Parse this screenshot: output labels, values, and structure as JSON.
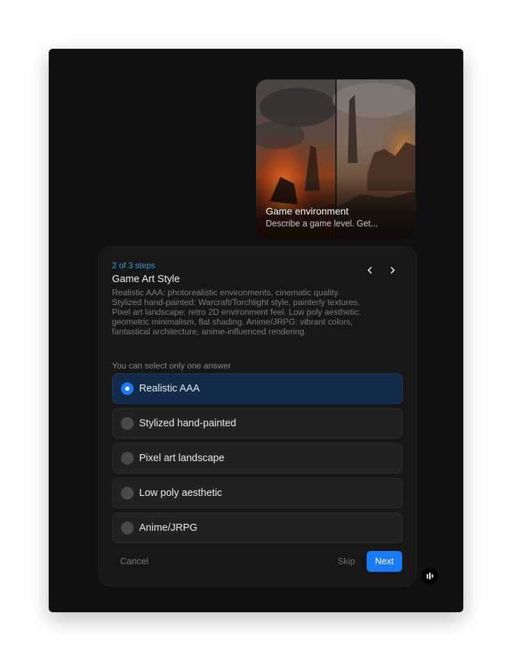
{
  "preview": {
    "title": "Game environment",
    "description": "Describe a game level. Get..."
  },
  "panel": {
    "step_count": "2 of 3 steps",
    "title": "Game Art Style",
    "description": "Realistic AAA: photorealistic environments, cinematic quality. Stylized hand-painted: Warcraft/Torchlight style, painterly textures. Pixel art landscape: retro 2D environment feel. Low poly aesthetic: geometric minimalism, flat shading. Anime/JRPG: vibrant colors, fantastical architecture, anime-influenced rendering.",
    "select_hint": "You can select only one answer",
    "options": [
      {
        "label": "Realistic AAA",
        "selected": true
      },
      {
        "label": "Stylized hand-painted",
        "selected": false
      },
      {
        "label": "Pixel art landscape",
        "selected": false
      },
      {
        "label": "Low poly aesthetic",
        "selected": false
      },
      {
        "label": "Anime/JRPG",
        "selected": false
      }
    ],
    "cancel_label": "Cancel",
    "skip_label": "Skip",
    "next_label": "Next"
  },
  "icons": {
    "prev": "chevron-left-icon",
    "next": "chevron-right-icon",
    "audio": "audio-wave-icon"
  },
  "colors": {
    "accent": "#1a7cf5",
    "step_text": "#3b9bd8",
    "selected_bg": "#132a4a",
    "window_bg": "#111111",
    "panel_bg": "#171717"
  }
}
